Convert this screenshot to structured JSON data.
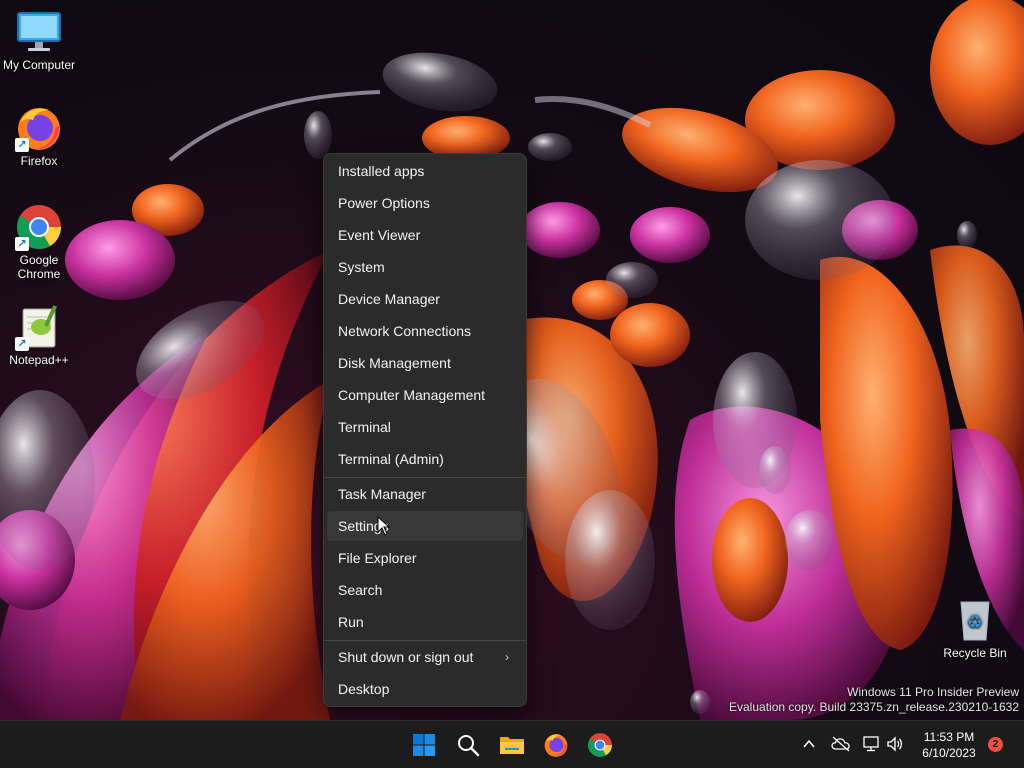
{
  "desktop": {
    "icons": [
      {
        "label": "My Computer",
        "icon": "monitor-icon"
      },
      {
        "label": "Firefox",
        "icon": "firefox-icon"
      },
      {
        "label": "Google Chrome",
        "icon": "chrome-icon"
      },
      {
        "label": "Notepad++",
        "icon": "notepadpp-icon"
      },
      {
        "label": "Recycle Bin",
        "icon": "recycle-bin-icon"
      }
    ]
  },
  "context_menu": {
    "group1": [
      "Installed apps",
      "Power Options",
      "Event Viewer",
      "System",
      "Device Manager",
      "Network Connections",
      "Disk Management",
      "Computer Management",
      "Terminal",
      "Terminal (Admin)"
    ],
    "group2": [
      "Task Manager",
      "Settings",
      "File Explorer",
      "Search",
      "Run"
    ],
    "group3": [
      "Shut down or sign out",
      "Desktop"
    ],
    "hovered_item": "Settings"
  },
  "watermark": {
    "line1": "Windows 11 Pro Insider Preview",
    "line2": "Evaluation copy. Build 23375.zn_release.230210-1632"
  },
  "taskbar": {
    "pinned": [
      "start-icon",
      "search-icon",
      "file-explorer-icon",
      "firefox-icon",
      "chrome-icon"
    ],
    "tray": {
      "time": "11:53 PM",
      "date": "6/10/2023",
      "notifications": "2"
    }
  },
  "colors": {
    "menu_bg": "#2b2b2b",
    "taskbar_bg": "#1c1c1c",
    "accent_blue": "#0f78d4",
    "badge": "#e8523c"
  }
}
